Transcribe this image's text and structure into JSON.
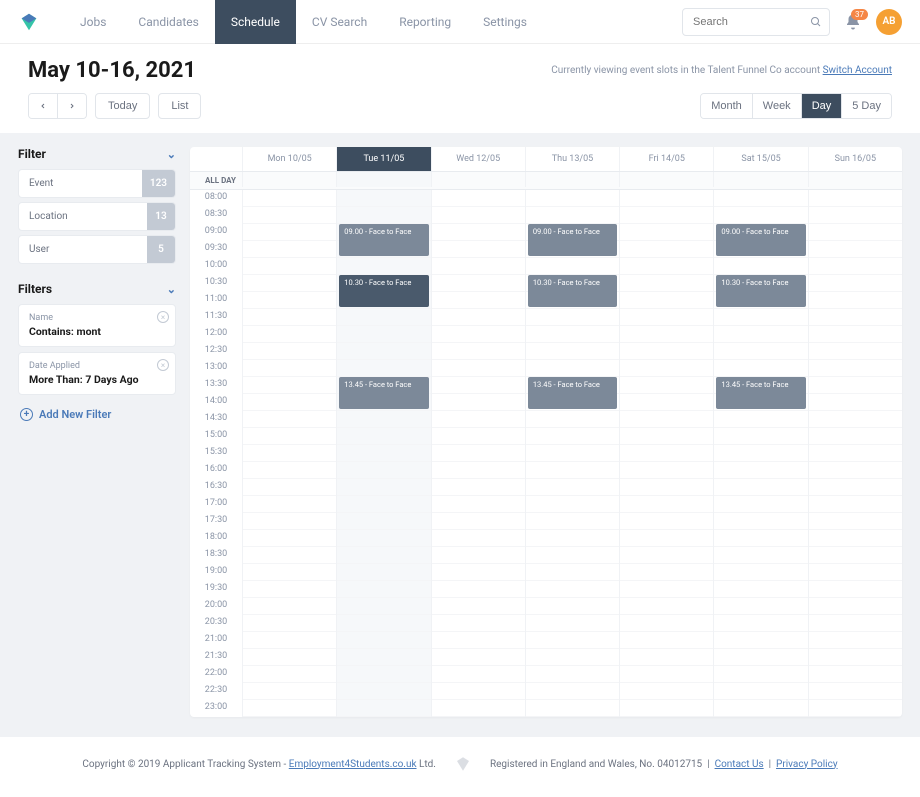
{
  "nav": {
    "items": [
      "Jobs",
      "Candidates",
      "Schedule",
      "CV Search",
      "Reporting",
      "Settings"
    ],
    "active": 2
  },
  "search": {
    "placeholder": "Search"
  },
  "notifications": {
    "count": "37"
  },
  "user": {
    "initials": "AB"
  },
  "page": {
    "title": "May 10-16, 2021",
    "viewing_prefix": "Currently viewing event slots in the Talent Funnel Co account ",
    "switch_link": "Switch Account"
  },
  "view_toggle": {
    "today": "Today",
    "list": "List"
  },
  "range_toggle": {
    "items": [
      "Month",
      "Week",
      "Day",
      "5 Day"
    ],
    "active": 2
  },
  "sidebar": {
    "filter_title": "Filter",
    "filter_items": [
      {
        "label": "Event",
        "count": "123"
      },
      {
        "label": "Location",
        "count": "13"
      },
      {
        "label": "User",
        "count": "5"
      }
    ],
    "filters_title": "Filters",
    "filters": [
      {
        "label": "Name",
        "value": "Contains: mont"
      },
      {
        "label": "Date Applied",
        "value": "More Than: 7 Days Ago"
      }
    ],
    "add_filter": "Add New Filter"
  },
  "calendar": {
    "allday_label": "ALL DAY",
    "days": [
      "Mon 10/05",
      "Tue 11/05",
      "Wed 12/05",
      "Thu 13/05",
      "Fri 14/05",
      "Sat 15/05",
      "Sun 16/05"
    ],
    "active_day": 1,
    "times": [
      "08:00",
      "08:30",
      "09:00",
      "09:30",
      "10:00",
      "10:30",
      "11:00",
      "11:30",
      "12:00",
      "12:30",
      "13:00",
      "13:30",
      "14:00",
      "14:30",
      "15:00",
      "15:30",
      "16:00",
      "16:30",
      "17:00",
      "17:30",
      "18:00",
      "18:30",
      "19:00",
      "19:30",
      "20:00",
      "20:30",
      "21:00",
      "21:30",
      "22:00",
      "22:30",
      "23:00"
    ],
    "events": [
      {
        "day": 1,
        "slot": 2,
        "span": 2,
        "label": "09.00 - Face to Face",
        "dark": false
      },
      {
        "day": 1,
        "slot": 5,
        "span": 2,
        "label": "10.30 - Face to Face",
        "dark": true
      },
      {
        "day": 1,
        "slot": 11,
        "span": 2,
        "label": "13.45 - Face to Face",
        "dark": false
      },
      {
        "day": 3,
        "slot": 2,
        "span": 2,
        "label": "09.00 - Face to Face",
        "dark": false
      },
      {
        "day": 3,
        "slot": 5,
        "span": 2,
        "label": "10.30 - Face to Face",
        "dark": false
      },
      {
        "day": 3,
        "slot": 11,
        "span": 2,
        "label": "13.45 - Face to Face",
        "dark": false
      },
      {
        "day": 5,
        "slot": 2,
        "span": 2,
        "label": "09.00 - Face to Face",
        "dark": false
      },
      {
        "day": 5,
        "slot": 5,
        "span": 2,
        "label": "10.30 - Face to Face",
        "dark": false
      },
      {
        "day": 5,
        "slot": 11,
        "span": 2,
        "label": "13.45 - Face to Face",
        "dark": false
      }
    ]
  },
  "footer": {
    "copyright_prefix": "Copyright © 2019 Applicant Tracking System - ",
    "e4s": "Employment4Students.co.uk",
    "copyright_suffix": " Ltd.",
    "registered": "Registered in England and Wales, No. 04012715",
    "contact": "Contact Us",
    "privacy": "Privacy Policy"
  }
}
